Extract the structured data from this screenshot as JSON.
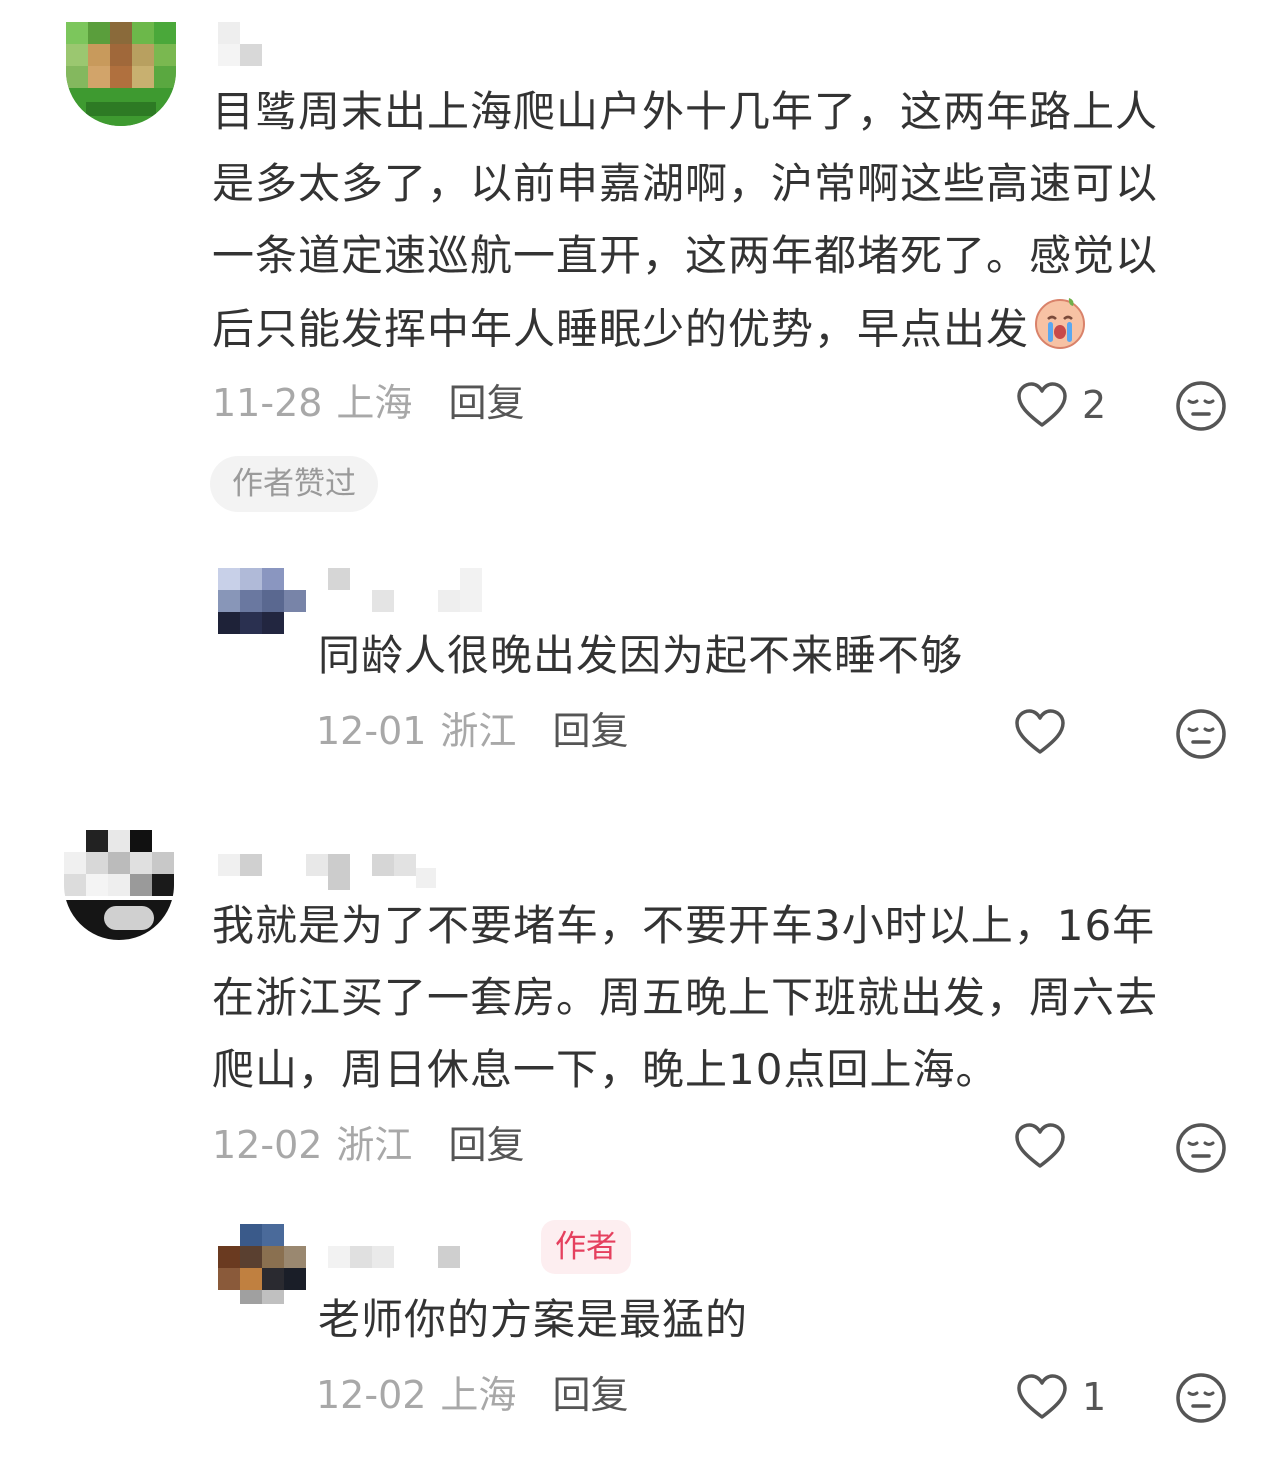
{
  "comments": [
    {
      "text_lines": [
        "目骘周末出上海爬山户外十几年了，这两年路上人",
        "是多太多了，以前申嘉湖啊，沪常啊这些高速可以",
        "一条道定速巡航一直开，这两年都堵死了。感觉以",
        "后只能发挥中年人睡眠少的优势，早点出发"
      ],
      "inline_emoji": "crying-face-emoji",
      "date": "11-28",
      "location": "上海",
      "reply_label": "回复",
      "like_count": "2",
      "author_liked_label": "作者赞过",
      "reply": {
        "text": "同龄人很晚出发因为起不来睡不够",
        "date": "12-01",
        "location": "浙江",
        "reply_label": "回复",
        "like_count": ""
      }
    },
    {
      "text_lines": [
        "我就是为了不要堵车，不要开车3小时以上，16年",
        "在浙江买了一套房。周五晚上下班就出发，周六去",
        "爬山，周日休息一下，晚上10点回上海。"
      ],
      "date": "12-02",
      "location": "浙江",
      "reply_label": "回复",
      "like_count": "",
      "reply": {
        "author_tag": "作者",
        "text": "老师你的方案是最猛的",
        "date": "12-02",
        "location": "上海",
        "reply_label": "回复",
        "like_count": "1"
      }
    }
  ],
  "icons": {
    "like": "heart-outline-icon",
    "emoji": "neutral-face-icon"
  },
  "colors": {
    "text": "#333333",
    "meta": "#a8a8a8",
    "author_tag_bg": "#fdeef0",
    "author_tag_text": "#e5405e",
    "author_liked_bg": "#f3f3f3"
  }
}
